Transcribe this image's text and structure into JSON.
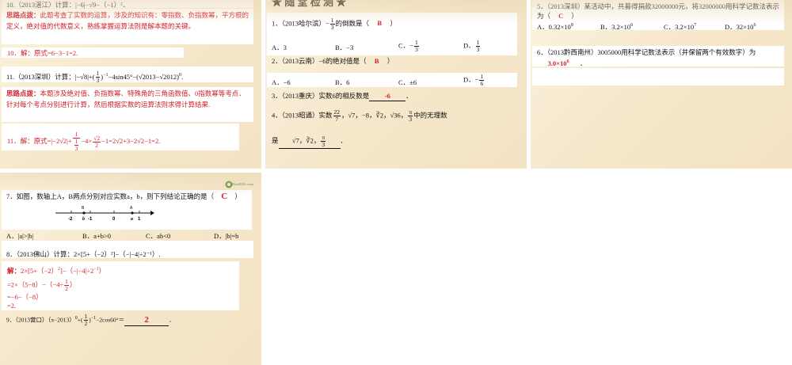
{
  "s1": {
    "q10_head": "10.（2013湛江）计算：|−6|−√9−（−1）²．",
    "q10_note_label": "思路点拨：",
    "q10_note": "此题考查了实数的运算，涉及的知识有：零指数、负指数幂，平方根的定义，绝对值的代数意义，熟练掌握运算法则是解本题的关键。",
    "q10_sol": "10．解：原式=6−3−1=2.",
    "q11_head": "11.（2013深圳）计算：|−√8|+(1/3)⁻¹−4sin45°−(√2013−√2012)⁰.",
    "q11_note_label": "思路点拨：",
    "q11_note": "本题涉及绝对值、负指数幂、特殊角的三角函数值、0指数幂等考点．针对每个考点分别进行计算，然后根据实数的运算法则求得计算结果.",
    "q11_sol": "11．解：原式=|−2√2|+ 1/(1/3) −4× √2/2 −1=2√2+3−2√2−1=2."
  },
  "s2": {
    "banner": "★ 随 堂 检 测 ★",
    "q1": "1．（2013哈尔滨）−1/3的倒数是（",
    "q1_ans": "B",
    "q1_opts": [
      "A．3",
      "B．−3",
      "C．−1/3",
      "D．1/3"
    ],
    "q2": "2．（2013云南）−6的绝对值是（",
    "q2_ans": "B",
    "q2_opts": [
      "A．−6",
      "B．6",
      "C．±6",
      "D．−1/6"
    ],
    "q3": "3．（2013重庆）实数6的相反数是",
    "q3_ans": "-6",
    "q4": "4．（2013昭通）实数22/7，√7，−8，∛2，√36，π/3中的无理数",
    "q4_tail": "是",
    "q4_ans": "√7，∛2，π/3"
  },
  "s3": {
    "q5": "5．（2013深圳）某活动中，共募得捐款32000000元，将32000000用科学记数法表示为（",
    "q5_ans": "C",
    "q5_opts": [
      "A．0.32×10⁸",
      "B．3.2×10⁶",
      "C．3.2×10⁷",
      "D．32×10⁶"
    ],
    "q6": "6．（2013黔西南州）3005000用科学记数法表示（并保留两个有效数字）为",
    "q6_ans": "3.0×10⁶"
  },
  "s4": {
    "logo": "DearEDU.com",
    "q7": "7．如图，数轴上A，B两点分别对应实数a，b，则下列结论正确的是（",
    "q7_ans": "C",
    "nl_labels": [
      "-2",
      "b",
      "-1",
      "0",
      "a",
      "1"
    ],
    "nl_points": [
      "B",
      "A"
    ],
    "q7_opts": [
      "A．|a|>|b|",
      "B．a+b>0",
      "C．ab<0",
      "D．|b|=b"
    ],
    "q8": "8．（2013佛山）计算：2×[5+（−2）²]−（−|−4|÷2⁻¹）.",
    "q8_sol": [
      "解：2×[5+（−2）²]−（−|−4|÷2⁻¹）",
      "=2×（5+4）−（−4÷1/2）",
      "=−6−（−8）",
      "=2."
    ],
    "q9": "9．（2013营口）（π−2013）⁰+(1/2)⁻¹−2cos60°＝",
    "q9_ans": "2"
  }
}
